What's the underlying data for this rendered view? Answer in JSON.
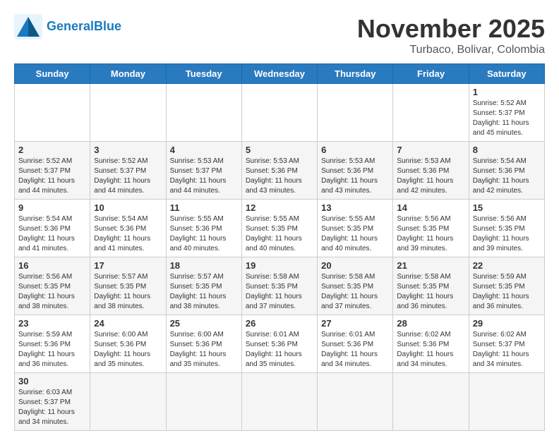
{
  "header": {
    "logo_general": "General",
    "logo_blue": "Blue",
    "month_title": "November 2025",
    "location": "Turbaco, Bolivar, Colombia"
  },
  "weekdays": [
    "Sunday",
    "Monday",
    "Tuesday",
    "Wednesday",
    "Thursday",
    "Friday",
    "Saturday"
  ],
  "weeks": [
    [
      {
        "day": "",
        "info": ""
      },
      {
        "day": "",
        "info": ""
      },
      {
        "day": "",
        "info": ""
      },
      {
        "day": "",
        "info": ""
      },
      {
        "day": "",
        "info": ""
      },
      {
        "day": "",
        "info": ""
      },
      {
        "day": "1",
        "info": "Sunrise: 5:52 AM\nSunset: 5:37 PM\nDaylight: 11 hours\nand 45 minutes."
      }
    ],
    [
      {
        "day": "2",
        "info": "Sunrise: 5:52 AM\nSunset: 5:37 PM\nDaylight: 11 hours\nand 44 minutes."
      },
      {
        "day": "3",
        "info": "Sunrise: 5:52 AM\nSunset: 5:37 PM\nDaylight: 11 hours\nand 44 minutes."
      },
      {
        "day": "4",
        "info": "Sunrise: 5:53 AM\nSunset: 5:37 PM\nDaylight: 11 hours\nand 44 minutes."
      },
      {
        "day": "5",
        "info": "Sunrise: 5:53 AM\nSunset: 5:36 PM\nDaylight: 11 hours\nand 43 minutes."
      },
      {
        "day": "6",
        "info": "Sunrise: 5:53 AM\nSunset: 5:36 PM\nDaylight: 11 hours\nand 43 minutes."
      },
      {
        "day": "7",
        "info": "Sunrise: 5:53 AM\nSunset: 5:36 PM\nDaylight: 11 hours\nand 42 minutes."
      },
      {
        "day": "8",
        "info": "Sunrise: 5:54 AM\nSunset: 5:36 PM\nDaylight: 11 hours\nand 42 minutes."
      }
    ],
    [
      {
        "day": "9",
        "info": "Sunrise: 5:54 AM\nSunset: 5:36 PM\nDaylight: 11 hours\nand 41 minutes."
      },
      {
        "day": "10",
        "info": "Sunrise: 5:54 AM\nSunset: 5:36 PM\nDaylight: 11 hours\nand 41 minutes."
      },
      {
        "day": "11",
        "info": "Sunrise: 5:55 AM\nSunset: 5:36 PM\nDaylight: 11 hours\nand 40 minutes."
      },
      {
        "day": "12",
        "info": "Sunrise: 5:55 AM\nSunset: 5:35 PM\nDaylight: 11 hours\nand 40 minutes."
      },
      {
        "day": "13",
        "info": "Sunrise: 5:55 AM\nSunset: 5:35 PM\nDaylight: 11 hours\nand 40 minutes."
      },
      {
        "day": "14",
        "info": "Sunrise: 5:56 AM\nSunset: 5:35 PM\nDaylight: 11 hours\nand 39 minutes."
      },
      {
        "day": "15",
        "info": "Sunrise: 5:56 AM\nSunset: 5:35 PM\nDaylight: 11 hours\nand 39 minutes."
      }
    ],
    [
      {
        "day": "16",
        "info": "Sunrise: 5:56 AM\nSunset: 5:35 PM\nDaylight: 11 hours\nand 38 minutes."
      },
      {
        "day": "17",
        "info": "Sunrise: 5:57 AM\nSunset: 5:35 PM\nDaylight: 11 hours\nand 38 minutes."
      },
      {
        "day": "18",
        "info": "Sunrise: 5:57 AM\nSunset: 5:35 PM\nDaylight: 11 hours\nand 38 minutes."
      },
      {
        "day": "19",
        "info": "Sunrise: 5:58 AM\nSunset: 5:35 PM\nDaylight: 11 hours\nand 37 minutes."
      },
      {
        "day": "20",
        "info": "Sunrise: 5:58 AM\nSunset: 5:35 PM\nDaylight: 11 hours\nand 37 minutes."
      },
      {
        "day": "21",
        "info": "Sunrise: 5:58 AM\nSunset: 5:35 PM\nDaylight: 11 hours\nand 36 minutes."
      },
      {
        "day": "22",
        "info": "Sunrise: 5:59 AM\nSunset: 5:35 PM\nDaylight: 11 hours\nand 36 minutes."
      }
    ],
    [
      {
        "day": "23",
        "info": "Sunrise: 5:59 AM\nSunset: 5:36 PM\nDaylight: 11 hours\nand 36 minutes."
      },
      {
        "day": "24",
        "info": "Sunrise: 6:00 AM\nSunset: 5:36 PM\nDaylight: 11 hours\nand 35 minutes."
      },
      {
        "day": "25",
        "info": "Sunrise: 6:00 AM\nSunset: 5:36 PM\nDaylight: 11 hours\nand 35 minutes."
      },
      {
        "day": "26",
        "info": "Sunrise: 6:01 AM\nSunset: 5:36 PM\nDaylight: 11 hours\nand 35 minutes."
      },
      {
        "day": "27",
        "info": "Sunrise: 6:01 AM\nSunset: 5:36 PM\nDaylight: 11 hours\nand 34 minutes."
      },
      {
        "day": "28",
        "info": "Sunrise: 6:02 AM\nSunset: 5:36 PM\nDaylight: 11 hours\nand 34 minutes."
      },
      {
        "day": "29",
        "info": "Sunrise: 6:02 AM\nSunset: 5:37 PM\nDaylight: 11 hours\nand 34 minutes."
      }
    ],
    [
      {
        "day": "30",
        "info": "Sunrise: 6:03 AM\nSunset: 5:37 PM\nDaylight: 11 hours\nand 34 minutes."
      },
      {
        "day": "",
        "info": ""
      },
      {
        "day": "",
        "info": ""
      },
      {
        "day": "",
        "info": ""
      },
      {
        "day": "",
        "info": ""
      },
      {
        "day": "",
        "info": ""
      },
      {
        "day": "",
        "info": ""
      }
    ]
  ]
}
